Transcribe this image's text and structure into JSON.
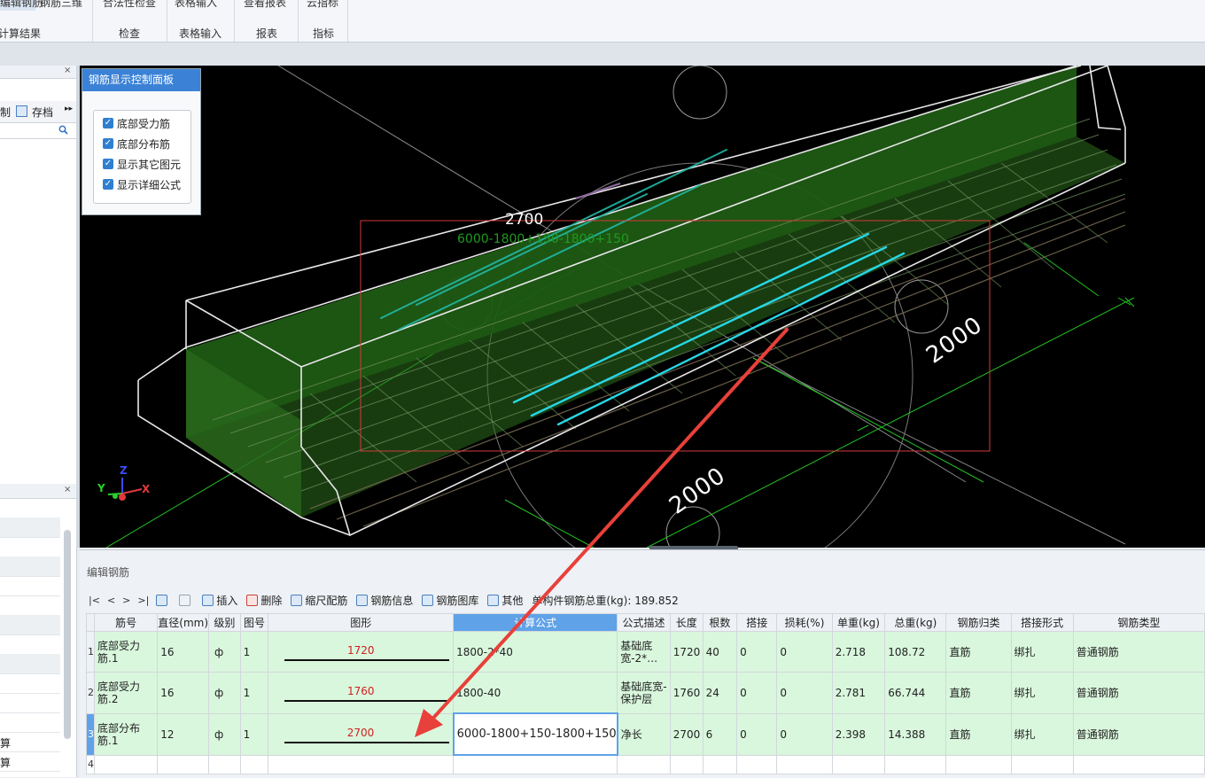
{
  "ribbon": {
    "tabs": [
      {
        "label": "编辑钢筋"
      },
      {
        "label": "钢筋三维"
      },
      {
        "label": "合法性检查"
      },
      {
        "label": "表格输入"
      },
      {
        "label": "查看报表"
      },
      {
        "label": "云指标"
      }
    ],
    "groups": [
      {
        "label": "计算结果"
      },
      {
        "label": "检查"
      },
      {
        "label": "表格输入"
      },
      {
        "label": "报表"
      },
      {
        "label": "指标"
      }
    ]
  },
  "left_panel": {
    "close": "×",
    "tool_partial": "制",
    "archive_label": "存档",
    "more": "▸▸",
    "bottom_rows": [
      "算",
      "算"
    ]
  },
  "control_panel": {
    "title": "钢筋显示控制面板",
    "options": [
      {
        "label": "底部受力筋",
        "checked": true
      },
      {
        "label": "底部分布筋",
        "checked": true
      },
      {
        "label": "显示其它图元",
        "checked": true
      },
      {
        "label": "显示详细公式",
        "checked": true
      }
    ]
  },
  "viewport": {
    "dim_main": "2700",
    "dim_formula": "6000-1800+150-1800+150",
    "dim_right": "2000",
    "dim_bottom": "2000",
    "axis_x": "X",
    "axis_y": "Y",
    "axis_z": "Z"
  },
  "edit_panel": {
    "title": "编辑钢筋",
    "toolbar": {
      "nav": [
        "|<",
        "<",
        ">",
        ">|"
      ],
      "insert": "插入",
      "delete": "删除",
      "scale_rebar": "缩尺配筋",
      "rebar_info": "钢筋信息",
      "rebar_library": "钢筋图库",
      "other": "其他",
      "total_weight": "单构件钢筋总重(kg): 189.852"
    },
    "columns": [
      "",
      "筋号",
      "直径(mm)",
      "级别",
      "图号",
      "图形",
      "计算公式",
      "公式描述",
      "长度",
      "根数",
      "搭接",
      "损耗(%)",
      "单重(kg)",
      "总重(kg)",
      "钢筋归类",
      "搭接形式",
      "钢筋类型"
    ],
    "rows": [
      {
        "rn": "1",
        "name": "底部受力筋.1",
        "dia": "16",
        "grade": "ф",
        "fig": "1",
        "shape": "1720",
        "formula": "1800-2*40",
        "desc": "基础底宽-2*…",
        "len": "1720",
        "count": "40",
        "lap": "0",
        "loss": "0",
        "unit_w": "2.718",
        "total_w": "108.72",
        "category": "直筋",
        "lap_type": "绑扎",
        "type": "普通钢筋"
      },
      {
        "rn": "2",
        "name": "底部受力筋.2",
        "dia": "16",
        "grade": "ф",
        "fig": "1",
        "shape": "1760",
        "formula": "1800-40",
        "desc": "基础底宽-保护层",
        "len": "1760",
        "count": "24",
        "lap": "0",
        "loss": "0",
        "unit_w": "2.781",
        "total_w": "66.744",
        "category": "直筋",
        "lap_type": "绑扎",
        "type": "普通钢筋"
      },
      {
        "rn": "3",
        "name": "底部分布筋.1",
        "dia": "12",
        "grade": "ф",
        "fig": "1",
        "shape": "2700",
        "formula": "6000-1800+150-1800+150",
        "desc": "净长",
        "len": "2700",
        "count": "6",
        "lap": "0",
        "loss": "0",
        "unit_w": "2.398",
        "total_w": "14.388",
        "category": "直筋",
        "lap_type": "绑扎",
        "type": "普通钢筋"
      },
      {
        "rn": "4",
        "name": "",
        "dia": "",
        "grade": "",
        "fig": "",
        "shape": "",
        "formula": "",
        "desc": "",
        "len": "",
        "count": "",
        "lap": "",
        "loss": "",
        "unit_w": "",
        "total_w": "",
        "category": "",
        "lap_type": "",
        "type": ""
      }
    ]
  },
  "colors": {
    "accent": "#3b82d6",
    "row_green": "#d9f7dd",
    "slab_green": "#1f5a14",
    "rebar_cyan": "#27d7e6",
    "arrow_red": "#e8403a"
  }
}
